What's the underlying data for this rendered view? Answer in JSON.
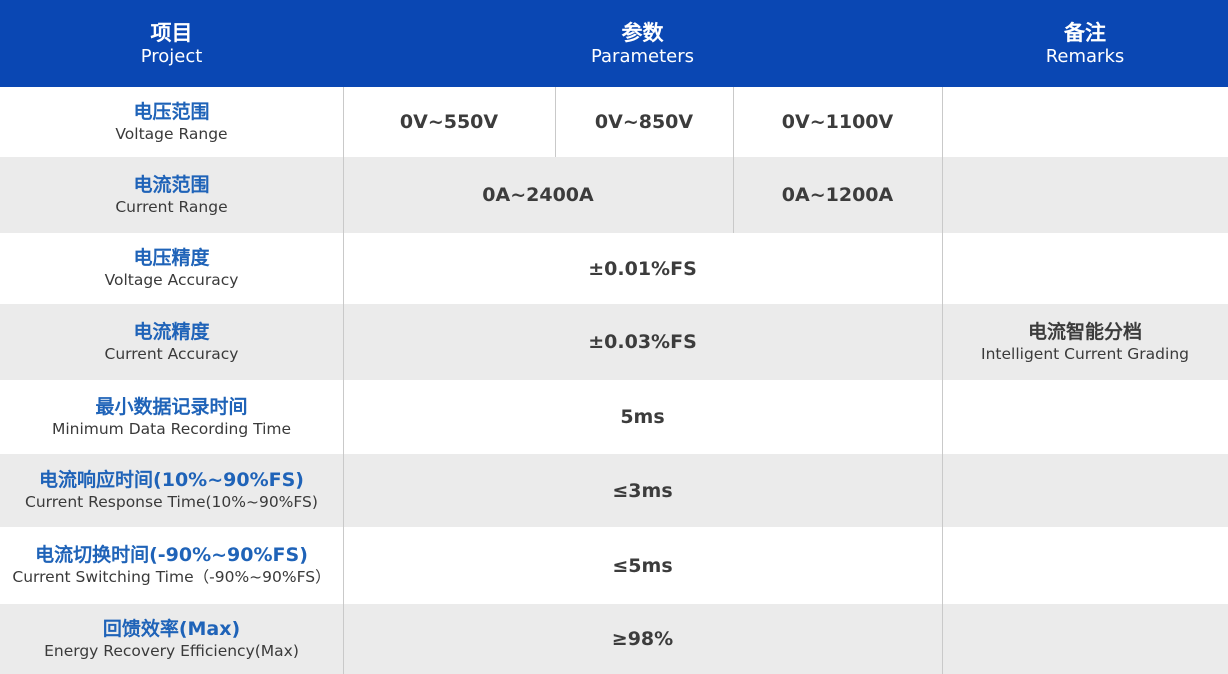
{
  "header": {
    "project": {
      "cn": "项目",
      "en": "Project"
    },
    "parameters": {
      "cn": "参数",
      "en": "Parameters"
    },
    "remarks": {
      "cn": "备注",
      "en": "Remarks"
    }
  },
  "rows": [
    {
      "label_cn": "电压范围",
      "label_en": "Voltage Range",
      "values": [
        "0V~550V",
        "0V~850V",
        "0V~1100V"
      ]
    },
    {
      "label_cn": "电流范围",
      "label_en": "Current Range",
      "values": [
        "0A~2400A",
        "0A~1200A"
      ]
    },
    {
      "label_cn": "电压精度",
      "label_en": "Voltage Accuracy",
      "values": [
        "±0.01%FS"
      ]
    },
    {
      "label_cn": "电流精度",
      "label_en": "Current Accuracy",
      "values": [
        "±0.03%FS"
      ]
    },
    {
      "label_cn": "最小数据记录时间",
      "label_en": "Minimum Data Recording Time",
      "values": [
        "5ms"
      ]
    },
    {
      "label_cn": "电流响应时间(10%~90%FS)",
      "label_en": "Current Response Time(10%~90%FS)",
      "values": [
        "≤3ms"
      ]
    },
    {
      "label_cn": "电流切换时间(-90%~90%FS)",
      "label_en": "Current Switching Time（-90%~90%FS）",
      "values": [
        "≤5ms"
      ]
    },
    {
      "label_cn": "回馈效率(Max)",
      "label_en": "Energy Recovery Efficiency(Max)",
      "values": [
        "≥98%"
      ]
    }
  ],
  "remark": {
    "cn": "电流智能分档",
    "en": "Intelligent Current Grading"
  },
  "colors": {
    "header_bg": "#0a47b3",
    "label_blue": "#1f63b8",
    "row_shade": "#ebebeb",
    "text": "#3c3c3c"
  }
}
